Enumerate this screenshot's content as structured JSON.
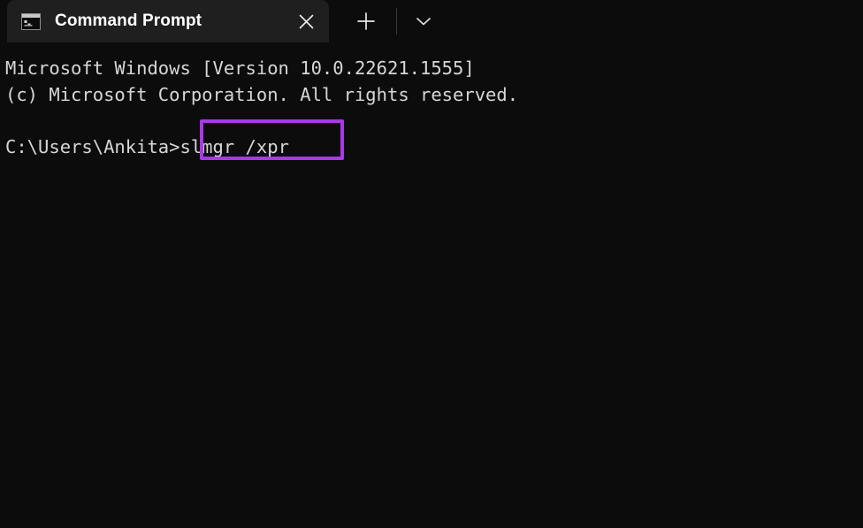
{
  "window": {
    "background_color": "#0c0c0c",
    "tab_background_color": "#1f1f1f"
  },
  "tabstrip": {
    "tab": {
      "title": "Command Prompt",
      "icon": "console-window-icon",
      "close_label": "✕"
    },
    "new_tab_label": "＋",
    "dropdown_label": "⌵"
  },
  "terminal": {
    "foreground_color": "#d6d6d6",
    "lines": [
      "Microsoft Windows [Version 10.0.22621.1555]",
      "(c) Microsoft Corporation. All rights reserved.",
      "",
      ""
    ],
    "prompt": "C:\\Users\\Ankita>",
    "command": "slmgr /xpr",
    "highlight": {
      "color": "#a83ae6",
      "target_text": "slmgr /xpr"
    }
  }
}
